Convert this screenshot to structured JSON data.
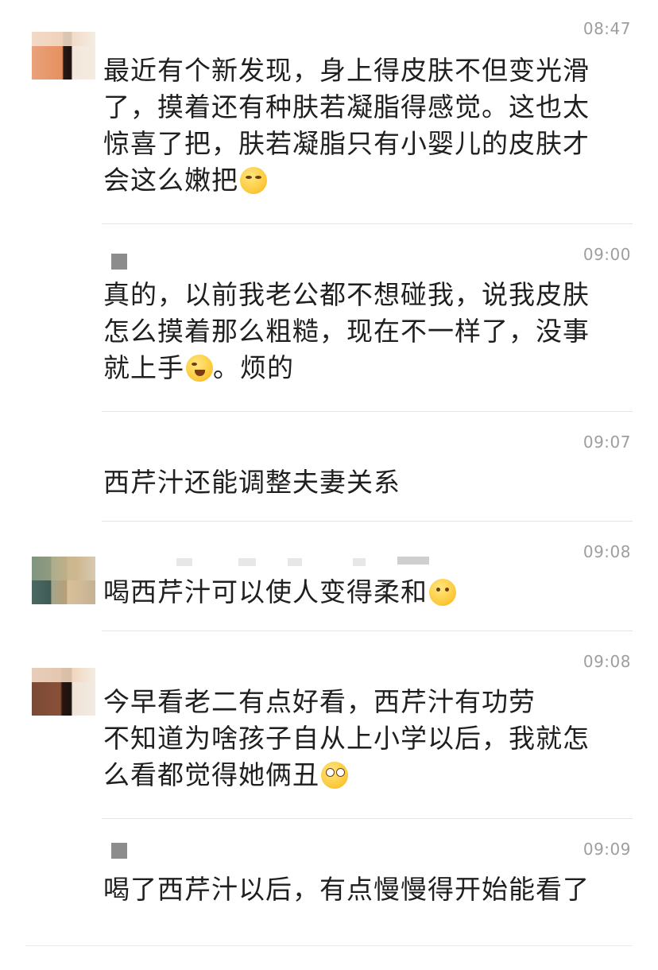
{
  "comments": [
    {
      "time": "08:47",
      "lines": [
        "最近有个新发现，身上得皮肤不但变光滑",
        "了，摸着还有种肤若凝脂得感觉。这也太",
        "惊喜了把，肤若凝脂只有小婴儿的皮肤才",
        "会这么嫩把"
      ],
      "emoji": "smug-face-emoji"
    },
    {
      "time": "09:00",
      "lines": [
        "真的，以前我老公都不想碰我，说我皮肤",
        "怎么摸着那么粗糙，现在不一样了，没事",
        "就上手",
        "。烦的"
      ],
      "emoji": "tears-of-joy-emoji"
    },
    {
      "time": "09:07",
      "lines": [
        "西芹汁还能调整夫妻关系"
      ]
    },
    {
      "time": "09:08",
      "lines": [
        "喝西芹汁可以使人变得柔和"
      ],
      "emoji": "thinking-face-emoji"
    },
    {
      "time": "09:08",
      "lines": [
        "今早看老二有点好看，西芹汁有功劳",
        "不知道为啥孩子自从上小学以后，我就怎",
        "么看都觉得她俩丑"
      ],
      "emoji": "rolling-eyes-emoji"
    },
    {
      "time": "09:09",
      "lines": [
        "喝了西芹汁以后，有点慢慢得开始能看了"
      ]
    }
  ]
}
